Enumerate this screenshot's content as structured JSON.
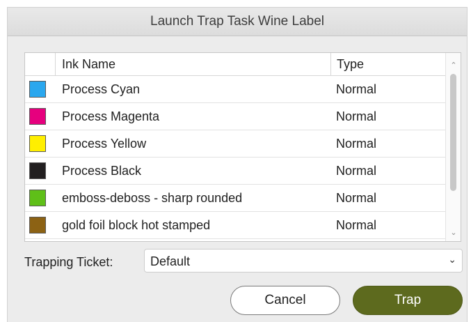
{
  "window": {
    "title": "Launch Trap Task Wine Label"
  },
  "table": {
    "headers": {
      "ink_name": "Ink Name",
      "type": "Type"
    },
    "rows": [
      {
        "name": "Process Cyan",
        "type": "Normal",
        "color": "#2aa7ee"
      },
      {
        "name": "Process Magenta",
        "type": "Normal",
        "color": "#e6007e"
      },
      {
        "name": "Process Yellow",
        "type": "Normal",
        "color": "#ffef00"
      },
      {
        "name": "Process Black",
        "type": "Normal",
        "color": "#221f20"
      },
      {
        "name": "emboss-deboss - sharp rounded",
        "type": "Normal",
        "color": "#5fbf18"
      },
      {
        "name": "gold foil block hot stamped",
        "type": "Normal",
        "color": "#8c6214"
      }
    ],
    "scroll": {
      "up_icon": "chevron-up-icon",
      "down_icon": "chevron-down-icon"
    }
  },
  "trapping_ticket": {
    "label": "Trapping Ticket:",
    "value": "Default"
  },
  "buttons": {
    "cancel": "Cancel",
    "trap": "Trap"
  },
  "colors": {
    "trap_button": "#5d6a1e"
  }
}
